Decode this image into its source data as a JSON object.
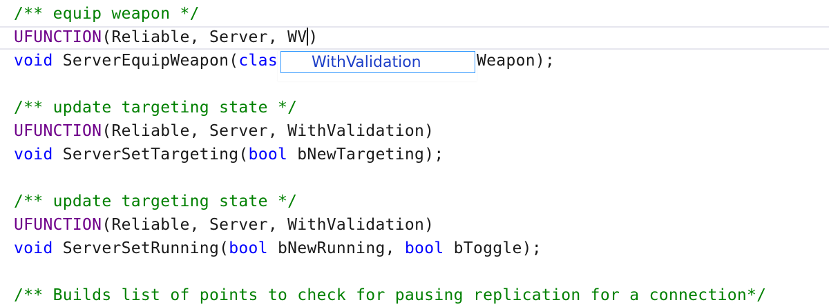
{
  "code_lines": {
    "l1": {
      "comment": "/** equip weapon */"
    },
    "l2": {
      "macro": "UFUNCTION",
      "text": "(Reliable, Server, WV",
      "close": ")"
    },
    "l3": {
      "kw": "void",
      "text_a": " ServerEquipWeapon(",
      "kw2": "clas",
      "text_b": "Weapon);"
    },
    "l4": {
      "comment": "/** update targeting state */"
    },
    "l5": {
      "macro": "UFUNCTION",
      "text": "(Reliable, Server, WithValidation)"
    },
    "l6": {
      "kw": "void",
      "text_a": " ServerSetTargeting(",
      "kw2": "bool",
      "text_b": " bNewTargeting);"
    },
    "l7": {
      "comment": "/** update targeting state */"
    },
    "l8": {
      "macro": "UFUNCTION",
      "text": "(Reliable, Server, WithValidation)"
    },
    "l9": {
      "kw": "void",
      "text_a": " ServerSetRunning(",
      "kw2": "bool",
      "text_b": " bNewRunning, ",
      "kw3": "bool",
      "text_c": " bToggle);"
    },
    "l10": {
      "comment": "/** Builds list of points to check for pausing replication for a connection*/"
    }
  },
  "autocomplete": {
    "items": [
      {
        "prefix": "With",
        "match": "V",
        "suffix": "alidation"
      }
    ]
  },
  "colors": {
    "keyword": "#0000ff",
    "macro": "#6f008a",
    "comment": "#008000",
    "selection_border": "#3399ff"
  }
}
